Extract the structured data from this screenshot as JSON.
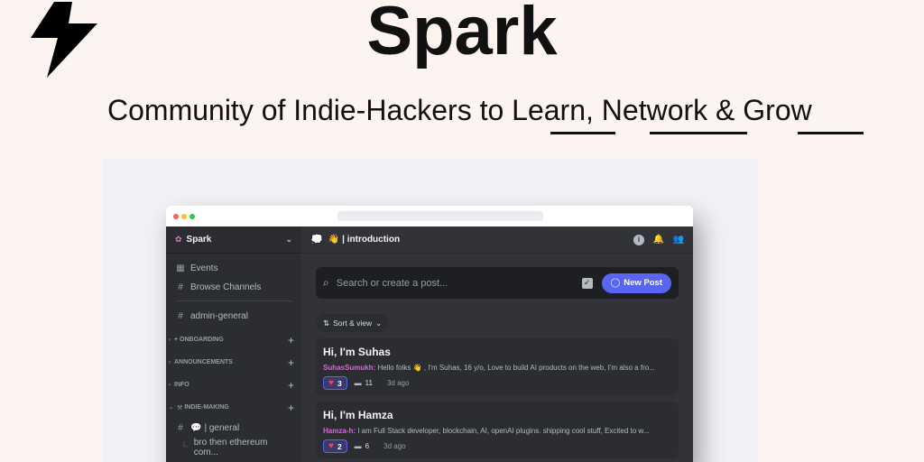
{
  "hero": {
    "title": "Spark",
    "tagline_prefix": "Community of Indie-Hackers to ",
    "word_learn": "Learn",
    "sep_1": ", ",
    "word_network": "Network",
    "sep_2": " & ",
    "word_grow": "Grow"
  },
  "sidebar": {
    "server_name": "Spark",
    "events": "Events",
    "browse_channels": "Browse Channels",
    "channel_admin": "admin-general",
    "categories": [
      {
        "label": "+ ONBOARDING"
      },
      {
        "label": "ANNOUNCEMENTS"
      },
      {
        "label": "INFO"
      },
      {
        "label": "INDIE-MAKING"
      }
    ],
    "channel_general": "| general",
    "thread": "bro then ethereum com..."
  },
  "header": {
    "channel_emoji": "👋",
    "channel_name": "| introduction"
  },
  "search": {
    "placeholder": "Search or create a post..."
  },
  "new_post_label": "New Post",
  "sort_label": "Sort & view",
  "posts": [
    {
      "title": "Hi, I'm Suhas",
      "author": "SuhasSumukh:",
      "preview": " Hello folks 👋 , I'm Suhas, 16 y/o, Love to build AI products on the web, I'm also a fro...",
      "reactions": "3",
      "comments": "11",
      "age": "3d ago"
    },
    {
      "title": "Hi, I'm Hamza",
      "author": "Hamza-h:",
      "preview": " I am Full Stack developer, blockchain, AI, openAI plugins. shipping cool stuff, Excited to w...",
      "reactions": "2",
      "comments": "6",
      "age": "3d ago"
    }
  ],
  "colors": {
    "background": "#fdf3f1",
    "accent": "#5865f2",
    "sidebar": "#2b2d31",
    "main": "#313338",
    "author": "#d16ad9",
    "heart": "#f23f5b"
  }
}
